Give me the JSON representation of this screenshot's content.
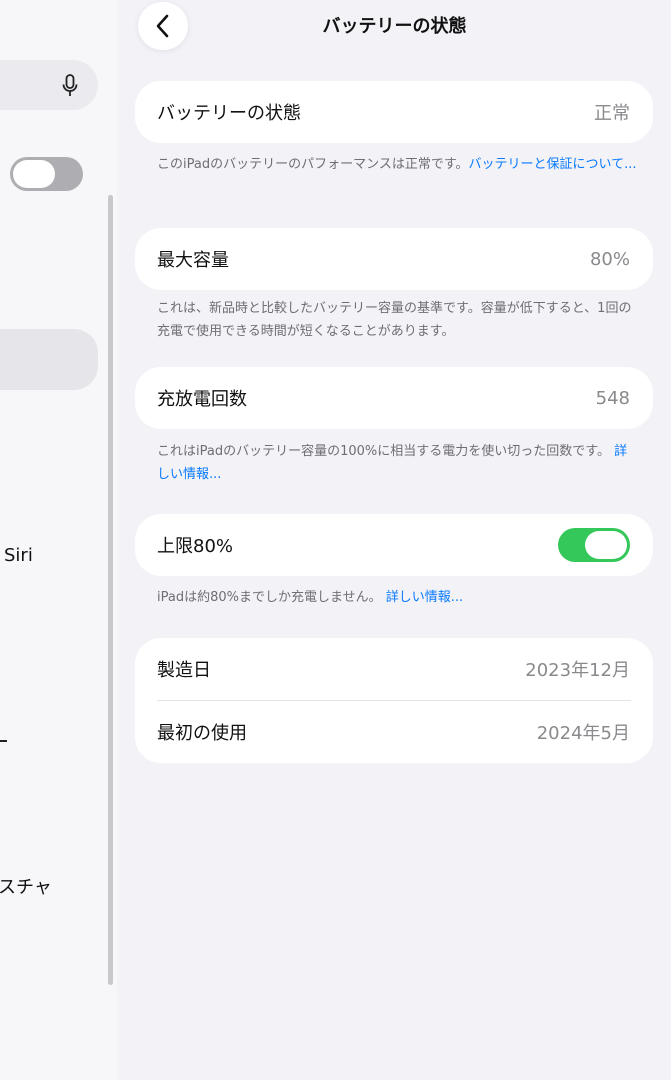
{
  "header": {
    "title": "バッテリーの状態"
  },
  "sidebar": {
    "items": [
      {
        "label": "Siri"
      },
      {
        "label": "スチャ"
      }
    ],
    "toggle_on": false
  },
  "battery_health": {
    "label": "バッテリーの状態",
    "value": "正常",
    "note": "このiPadのバッテリーのパフォーマンスは正常です。",
    "link": "バッテリーと保証について..."
  },
  "max_capacity": {
    "label": "最大容量",
    "value": "80%",
    "note": "これは、新品時と比較したバッテリー容量の基準です。容量が低下すると、1回の充電で使用できる時間が短くなることがあります。"
  },
  "cycle_count": {
    "label": "充放電回数",
    "value": "548",
    "note": "これはiPadのバッテリー容量の100%に相当する電力を使い切った回数です。",
    "link": "詳しい情報..."
  },
  "limit": {
    "label": "上限80%",
    "on": true,
    "note": "iPadは約80%までしか充電しません。",
    "link": "詳しい情報..."
  },
  "dates": {
    "manufacture_label": "製造日",
    "manufacture_value": "2023年12月",
    "first_use_label": "最初の使用",
    "first_use_value": "2024年5月"
  },
  "colors": {
    "accent": "#0a7aff",
    "toggle_on": "#34c759",
    "background": "#f2f2f7"
  }
}
